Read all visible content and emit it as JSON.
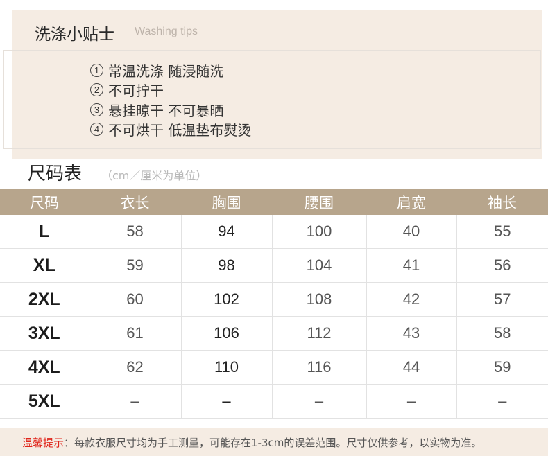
{
  "washing": {
    "title": "洗涤小贴士",
    "subtitle": "Washing tips",
    "tips": [
      {
        "num": "1",
        "text": "常温洗涤 随浸随洗"
      },
      {
        "num": "2",
        "text": "不可拧干"
      },
      {
        "num": "3",
        "text": "悬挂晾干  不可暴晒"
      },
      {
        "num": "4",
        "text": "不可烘干  低温垫布熨烫"
      }
    ]
  },
  "size_chart": {
    "title": "尺码表",
    "unit": "（cm／厘米为单位）",
    "headers": [
      "尺码",
      "衣长",
      "胸围",
      "腰围",
      "肩宽",
      "袖长"
    ],
    "rows": [
      [
        "L",
        "58",
        "94",
        "100",
        "40",
        "55"
      ],
      [
        "XL",
        "59",
        "98",
        "104",
        "41",
        "56"
      ],
      [
        "2XL",
        "60",
        "102",
        "108",
        "42",
        "57"
      ],
      [
        "3XL",
        "61",
        "106",
        "112",
        "43",
        "58"
      ],
      [
        "4XL",
        "62",
        "110",
        "116",
        "44",
        "59"
      ],
      [
        "5XL",
        "–",
        "–",
        "–",
        "–",
        "–"
      ]
    ]
  },
  "note": {
    "label": "温馨提示",
    "text": "：每款衣服尺寸均为手工测量，可能存在1-3cm的误差范围。尺寸仅供参考，以实物为准。"
  },
  "colors": {
    "panel_bg": "#f5ece3",
    "header_bg": "#b7a58c",
    "highlight": "#e0251b"
  }
}
